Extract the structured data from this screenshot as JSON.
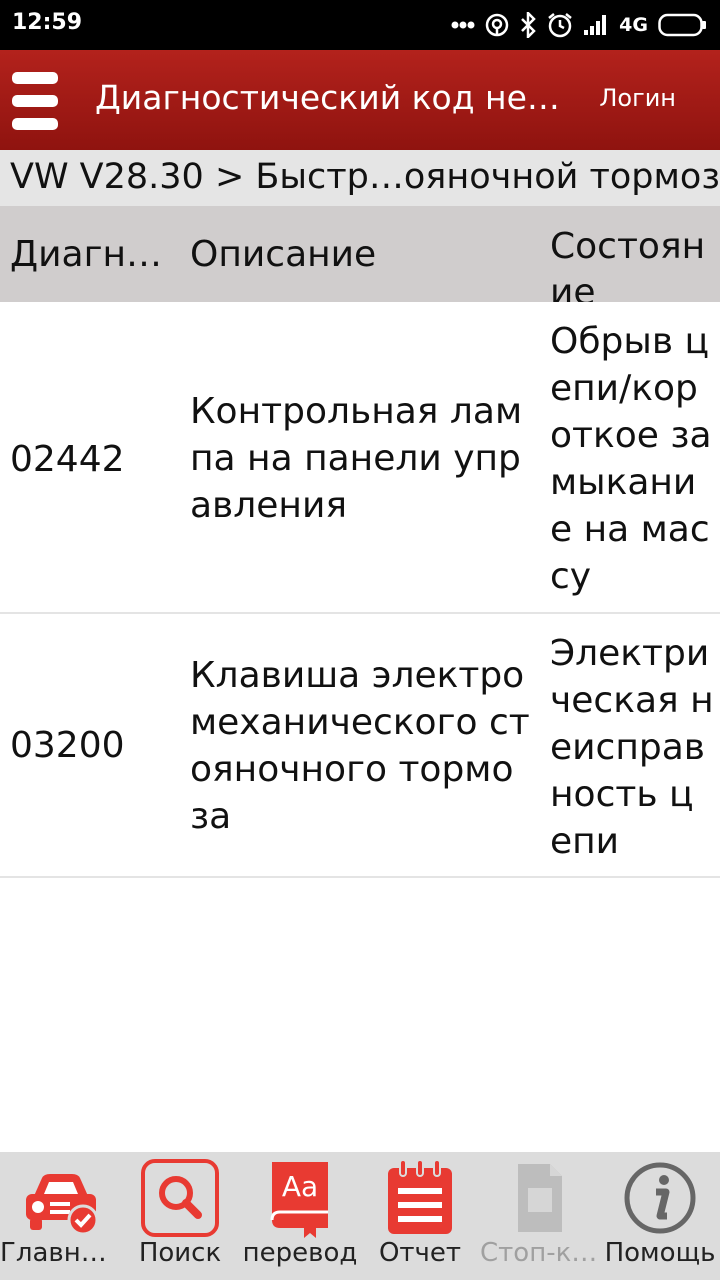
{
  "status_bar": {
    "time": "12:59",
    "network": "4G"
  },
  "app_bar": {
    "title": "Диагностический код не…",
    "login": "Логин"
  },
  "breadcrumb": "VW V28.30 > Быстр…ояночной тормоз",
  "table": {
    "headers": [
      "Диагн…",
      "Описание",
      "Состоян ие"
    ],
    "rows": [
      {
        "code": "02442",
        "description": "Контрольная лампа на панели управления",
        "state": "Обрыв цепи/короткое замыкание на массу"
      },
      {
        "code": "03200",
        "description": "Клавиша электромеханического стояночного тормоза",
        "state": "Электрическая неисправность цепи"
      }
    ]
  },
  "bottom_nav": [
    {
      "label": "Главна…",
      "icon": "car-home-icon"
    },
    {
      "label": "Поиск",
      "icon": "search-icon"
    },
    {
      "label": "перевод",
      "icon": "translate-icon"
    },
    {
      "label": "Отчет",
      "icon": "report-icon"
    },
    {
      "label": "Стоп-ка…",
      "icon": "freeze-frame-icon",
      "disabled": true
    },
    {
      "label": "Помощь",
      "icon": "info-icon"
    }
  ],
  "colors": {
    "accent": "#a81b16",
    "icon_red": "#e83a32",
    "header_bg": "#d0cdcd"
  }
}
